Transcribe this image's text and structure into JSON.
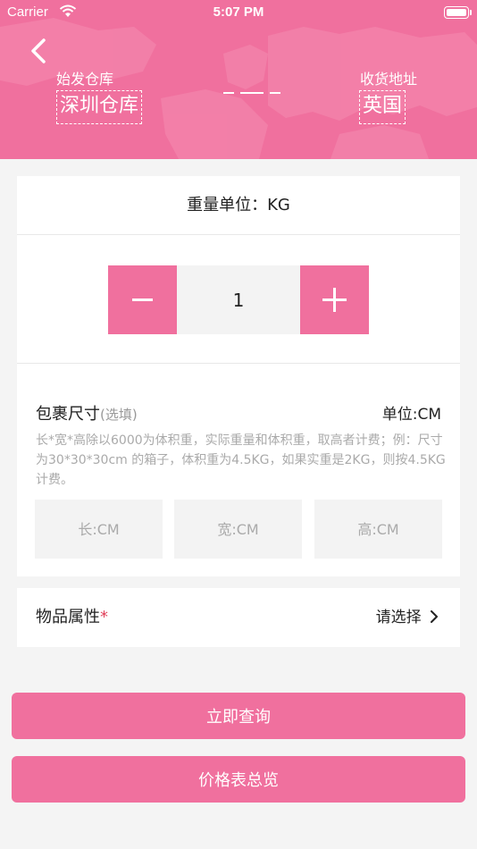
{
  "status_bar": {
    "carrier": "Carrier",
    "time": "5:07 PM"
  },
  "header": {
    "origin_label": "始发仓库",
    "origin_value": "深圳仓库",
    "destination_label": "收货地址",
    "destination_value": "英国"
  },
  "weight": {
    "unit_text": "重量单位：KG",
    "quantity": "1"
  },
  "package_size": {
    "title": "包裹尺寸",
    "optional": "(选填)",
    "unit": "单位:CM",
    "note": "长*宽*高除以6000为体积重，实际重量和体积重，取高者计费；例：尺寸为30*30*30cm 的箱子，体积重为4.5KG，如果实重是2KG，则按4.5KG计费。",
    "length_placeholder": "长:CM",
    "width_placeholder": "宽:CM",
    "height_placeholder": "高:CM"
  },
  "item_attribute": {
    "label": "物品属性",
    "required_mark": "*",
    "select_text": "请选择"
  },
  "buttons": {
    "query": "立即查询",
    "price_overview": "价格表总览"
  },
  "colors": {
    "accent": "#f0709e",
    "background": "#f4f4f4"
  }
}
